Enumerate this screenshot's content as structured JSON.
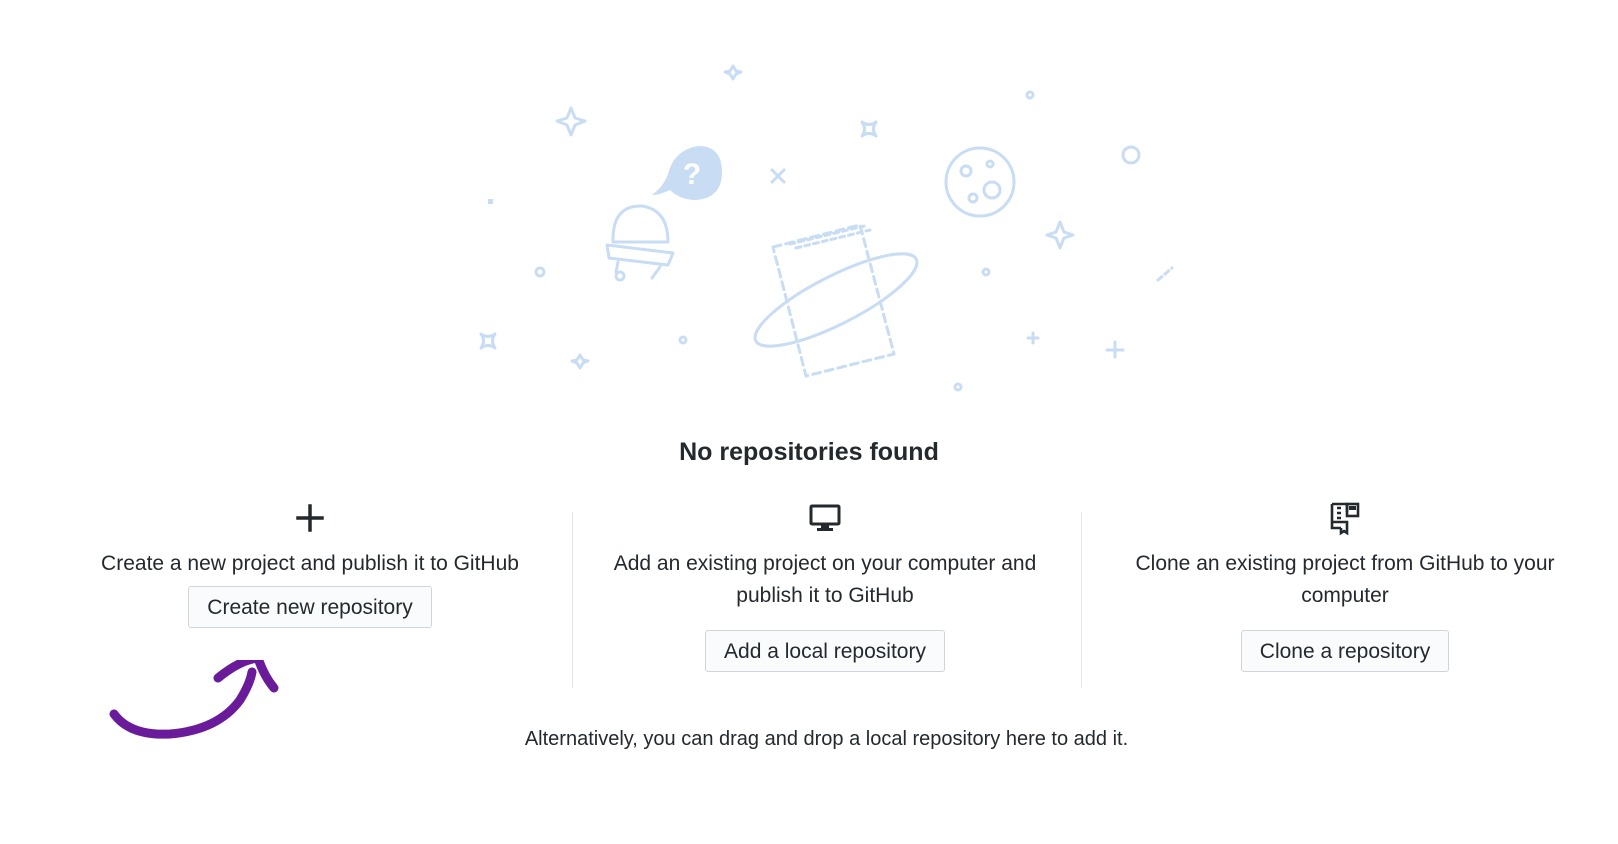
{
  "main": {
    "title": "No repositories found",
    "footer": "Alternatively, you can drag and drop a local repository here to add it."
  },
  "options": [
    {
      "icon": "plus-icon",
      "description": "Create a new project and publish it to GitHub",
      "button_label": "Create new repository"
    },
    {
      "icon": "desktop-computer-icon",
      "description": "Add an existing project on your computer and publish it to GitHub",
      "button_label": "Add a local repository"
    },
    {
      "icon": "repo-clone-icon",
      "description": "Clone an existing project from GitHub to your computer",
      "button_label": "Clone a repository"
    }
  ],
  "colors": {
    "illustration": "#c8ddf3",
    "annotation_arrow": "#6a1b9a",
    "text": "#24292e",
    "button_bg": "#fafbfc",
    "button_border": "#d1d5da"
  }
}
